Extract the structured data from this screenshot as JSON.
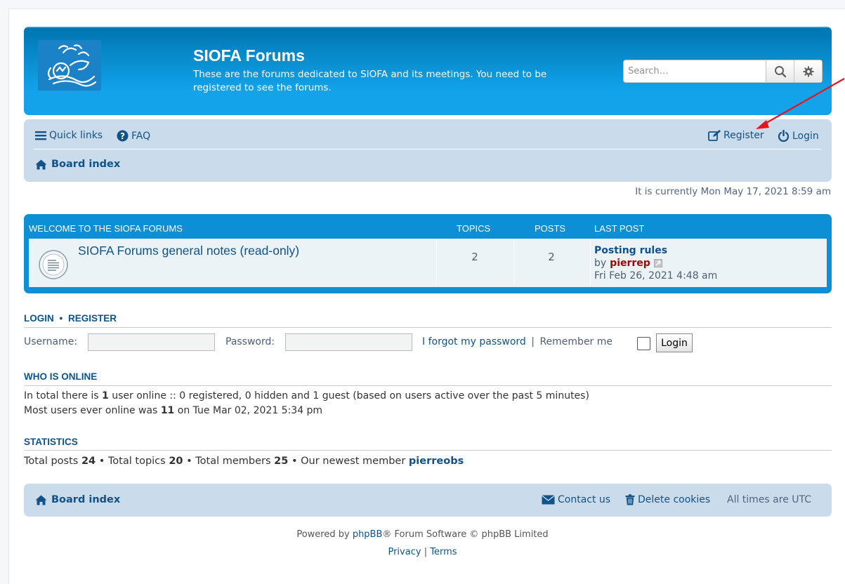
{
  "header": {
    "title": "SIOFA Forums",
    "description": "These are the forums dedicated to SIOFA and its meetings. You need to be registered to see the forums.",
    "search_placeholder": "Search…"
  },
  "nav": {
    "quick_links": "Quick links",
    "faq": "FAQ",
    "register": "Register",
    "login": "Login",
    "breadcrumb": "Board index"
  },
  "datetime": "It is currently Mon May 17, 2021 8:59 am",
  "forum_table": {
    "headers": {
      "section": "WELCOME TO THE SIOFA FORUMS",
      "topics": "TOPICS",
      "posts": "POSTS",
      "last_post": "LAST POST"
    },
    "rows": [
      {
        "title": "SIOFA Forums general notes (read-only)",
        "topics": "2",
        "posts": "2",
        "last_post_title": "Posting rules",
        "last_post_by": "by",
        "last_post_user": "pierrep",
        "last_post_date": "Fri Feb 26, 2021 4:48 am"
      }
    ]
  },
  "login": {
    "heading_login": "LOGIN",
    "heading_sep": "•",
    "heading_register": "REGISTER",
    "username_label": "Username:",
    "password_label": "Password:",
    "forgot": "I forgot my password",
    "pipe": "|",
    "remember": "Remember me",
    "button": "Login"
  },
  "who_is_online": {
    "heading": "WHO IS ONLINE",
    "line1_pre": "In total there is ",
    "line1_count": "1",
    "line1_post": " user online :: 0 registered, 0 hidden and 1 guest (based on users active over the past 5 minutes)",
    "line2_pre": "Most users ever online was ",
    "line2_count": "11",
    "line2_post": " on Tue Mar 02, 2021 5:34 pm"
  },
  "statistics": {
    "heading": "STATISTICS",
    "posts_label": "Total posts ",
    "posts": "24",
    "topics_label": " • Total topics ",
    "topics": "20",
    "members_label": " • Total members ",
    "members": "25",
    "newest_label": " • Our newest member ",
    "newest": "pierreobs"
  },
  "footer": {
    "breadcrumb": "Board index",
    "contact": "Contact us",
    "delete_cookies": "Delete cookies",
    "timezone": "All times are UTC",
    "powered_pre": "Powered by ",
    "phpbb": "phpBB",
    "powered_post": "® Forum Software © phpBB Limited",
    "privacy": "Privacy",
    "sep": "|",
    "terms": "Terms"
  },
  "colors": {
    "header_blue": "#12a3eb",
    "nav_bg": "#cadceb",
    "link": "#105289",
    "user_red": "#aa0000",
    "annotation_arrow": "#e8141b"
  },
  "icons": [
    "logo-icon",
    "search-icon",
    "gear-icon",
    "bars-icon",
    "question-icon",
    "edit-icon",
    "power-icon",
    "home-icon",
    "forum-read-icon",
    "view-latest-post-icon",
    "envelope-icon",
    "trash-icon"
  ]
}
